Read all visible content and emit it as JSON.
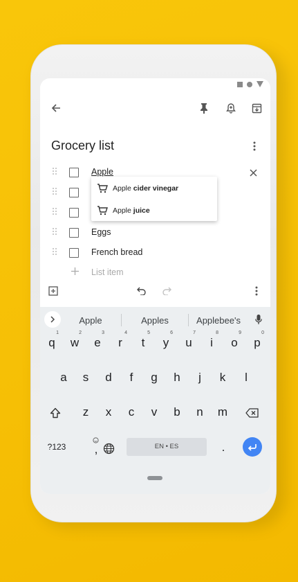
{
  "note": {
    "title": "Grocery list",
    "items": [
      {
        "label": "Apple"
      },
      {
        "label": ""
      },
      {
        "label": ""
      },
      {
        "label": "Eggs"
      },
      {
        "label": "French bread"
      }
    ],
    "add_placeholder": "List item"
  },
  "autocomplete": [
    {
      "prefix": "Apple",
      "bold": "cider vinegar"
    },
    {
      "prefix": "Apple",
      "bold": "juice"
    }
  ],
  "keyboard": {
    "suggestions": [
      "Apple",
      "Apples",
      "Applebee's"
    ],
    "row1": [
      {
        "k": "q",
        "n": "1"
      },
      {
        "k": "w",
        "n": "2"
      },
      {
        "k": "e",
        "n": "3"
      },
      {
        "k": "r",
        "n": "4"
      },
      {
        "k": "t",
        "n": "5"
      },
      {
        "k": "y",
        "n": "6"
      },
      {
        "k": "u",
        "n": "7"
      },
      {
        "k": "i",
        "n": "8"
      },
      {
        "k": "o",
        "n": "9"
      },
      {
        "k": "p",
        "n": "0"
      }
    ],
    "row2": [
      "a",
      "s",
      "d",
      "f",
      "g",
      "h",
      "j",
      "k",
      "l"
    ],
    "row3": [
      "z",
      "x",
      "c",
      "v",
      "b",
      "n",
      "m"
    ],
    "numbers_key": "?123",
    "comma_key": ",",
    "period_key": ".",
    "space_label": "EN • ES"
  },
  "colors": {
    "accent": "#4285f4",
    "background": "#f7c108"
  },
  "icons": [
    "back-arrow-icon",
    "pin-icon",
    "reminder-icon",
    "archive-icon",
    "more-vert-icon",
    "close-icon",
    "add-box-icon",
    "undo-icon",
    "redo-icon",
    "cart-icon",
    "mic-icon",
    "shift-icon",
    "backspace-icon",
    "globe-icon",
    "enter-icon",
    "emoji-icon"
  ]
}
